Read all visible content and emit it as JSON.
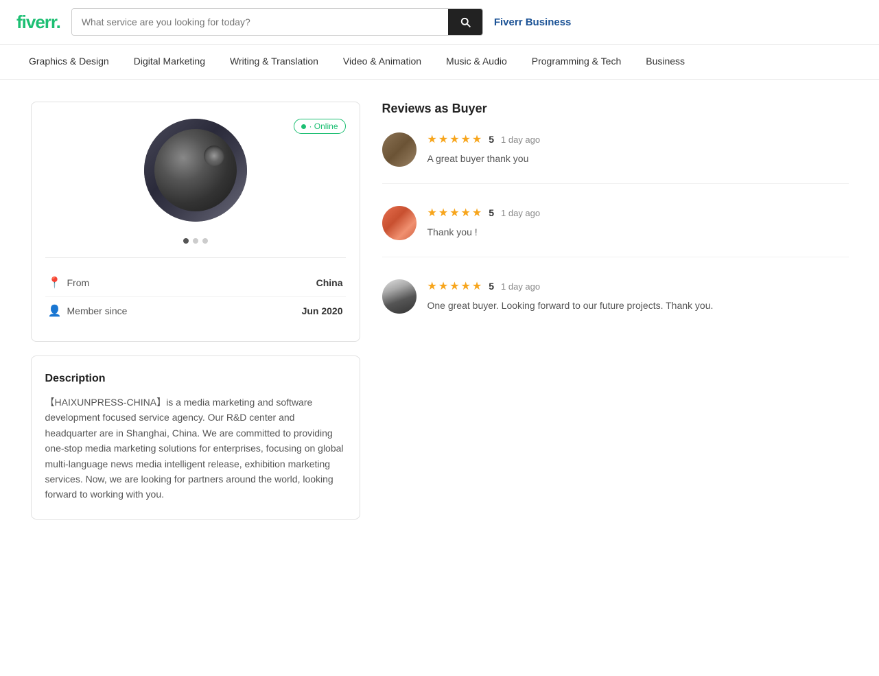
{
  "header": {
    "logo": "fiverr",
    "logo_dot": ".",
    "search_placeholder": "What service are you looking for today?",
    "fiverr_business_label": "Fiverr Business"
  },
  "nav": {
    "items": [
      {
        "id": "graphics-design",
        "label": "Graphics & Design"
      },
      {
        "id": "digital-marketing",
        "label": "Digital Marketing"
      },
      {
        "id": "writing-translation",
        "label": "Writing & Translation"
      },
      {
        "id": "video-animation",
        "label": "Video & Animation"
      },
      {
        "id": "music-audio",
        "label": "Music & Audio"
      },
      {
        "id": "programming-tech",
        "label": "Programming & Tech"
      },
      {
        "id": "business",
        "label": "Business"
      }
    ]
  },
  "profile": {
    "online_badge": "· Online",
    "pagination_dots": 3,
    "from_label": "From",
    "from_value": "China",
    "member_since_label": "Member since",
    "member_since_value": "Jun 2020"
  },
  "description": {
    "title": "Description",
    "text": "【HAIXUNPRESS-CHINA】is a media marketing and software development focused service agency. Our R&D center and headquarter are in Shanghai, China. We are committed to providing one-stop media marketing solutions for enterprises, focusing on global multi-language news media intelligent release, exhibition marketing services. Now, we are looking for partners around the world, looking forward to working with you."
  },
  "reviews": {
    "section_title": "Reviews as Buyer",
    "items": [
      {
        "id": "review-1",
        "avatar_class": "av1",
        "stars": 5,
        "star_count": "5",
        "time": "1 day ago",
        "text": "A great buyer thank you"
      },
      {
        "id": "review-2",
        "avatar_class": "av2",
        "stars": 5,
        "star_count": "5",
        "time": "1 day ago",
        "text": "Thank you !"
      },
      {
        "id": "review-3",
        "avatar_class": "av3",
        "stars": 5,
        "star_count": "5",
        "time": "1 day ago",
        "text": "One great buyer. Looking forward to our future projects. Thank you."
      }
    ]
  }
}
